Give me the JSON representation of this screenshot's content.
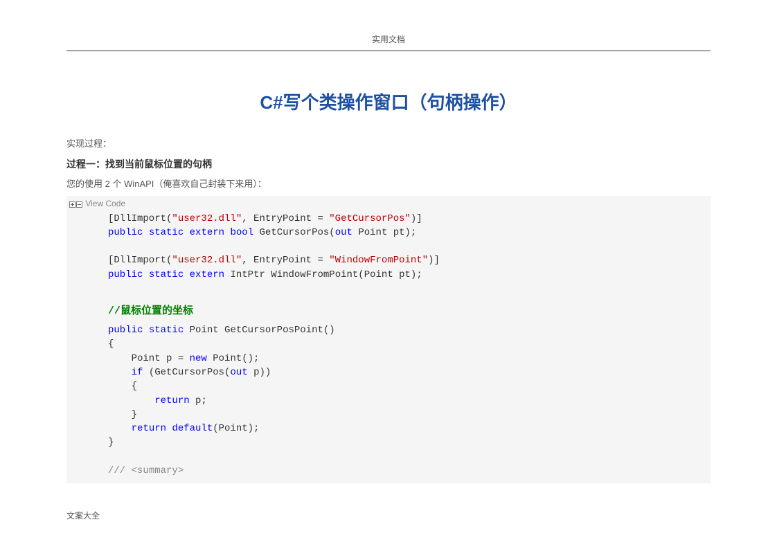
{
  "header": {
    "label": "实用文档"
  },
  "title": "C#写个类操作窗口（句柄操作）",
  "intro": {
    "line1": "实现过程：",
    "step_title": "过程一：找到当前鼠标位置的句柄",
    "line2": "您的使用 2 个 WinAPI（俺喜欢自己封装下来用）："
  },
  "code": {
    "view_label": "View Code",
    "import1_open": "[DllImport(",
    "import_dll": "\"user32.dll\"",
    "import1_ep": ", EntryPoint = ",
    "import1_epv": "\"GetCursorPos\"",
    "import1_close": ")]",
    "decl1_a": "public",
    "decl1_b": "static",
    "decl1_c": "extern",
    "decl1_d": "bool",
    "decl1_rest": " GetCursorPos(",
    "decl1_out": "out",
    "decl1_rest2": " Point pt);",
    "import2_epv": "\"WindowFromPoint\"",
    "decl2_rest": " IntPtr WindowFromPoint(Point pt);",
    "comment_label": "//鼠标位置的坐标",
    "m_pub": "public",
    "m_static": "static",
    "m_sig": " Point GetCursorPosPoint()",
    "brace_open": "{",
    "line_point": "    Point p = ",
    "m_new": "new",
    "line_point2": " Point();",
    "m_if": "if",
    "line_if": " (GetCursorPos(",
    "m_out": "out",
    "line_if2": " p))",
    "brace_open2": "    {",
    "m_return": "return",
    "line_ret": " p;",
    "brace_close2": "    }",
    "m_return2": "return",
    "m_default": "default",
    "line_default": "(Point);",
    "brace_close": "}",
    "summary_slash": "///",
    "summary_tag": " <summary>"
  },
  "footer": {
    "label": "文案大全"
  }
}
